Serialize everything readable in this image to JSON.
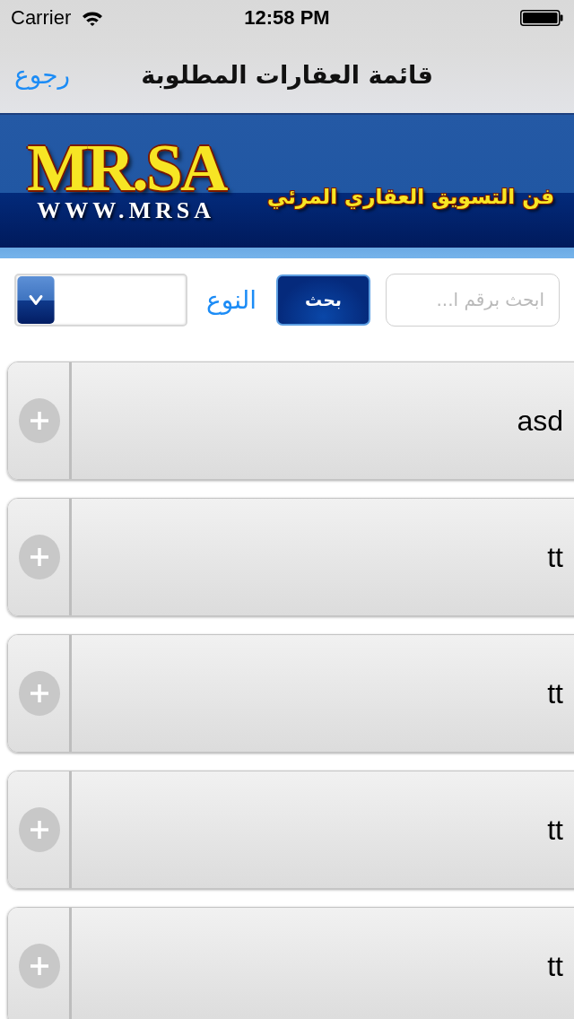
{
  "status_bar": {
    "carrier": "Carrier",
    "time": "12:58 PM"
  },
  "nav_bar": {
    "back": "رجوع",
    "title": "قائمة العقارات المطلوبة"
  },
  "banner": {
    "logo": "MR.SA",
    "website": "WWW.MRSA",
    "tagline": "فن التسويق العقاري المرئي"
  },
  "search": {
    "placeholder": "ابحث برقم ا...",
    "button": "بحث",
    "type_label": "النوع"
  },
  "items": [
    {
      "title": "asd"
    },
    {
      "title": "tt"
    },
    {
      "title": "tt"
    },
    {
      "title": "tt"
    },
    {
      "title": "tt"
    }
  ]
}
